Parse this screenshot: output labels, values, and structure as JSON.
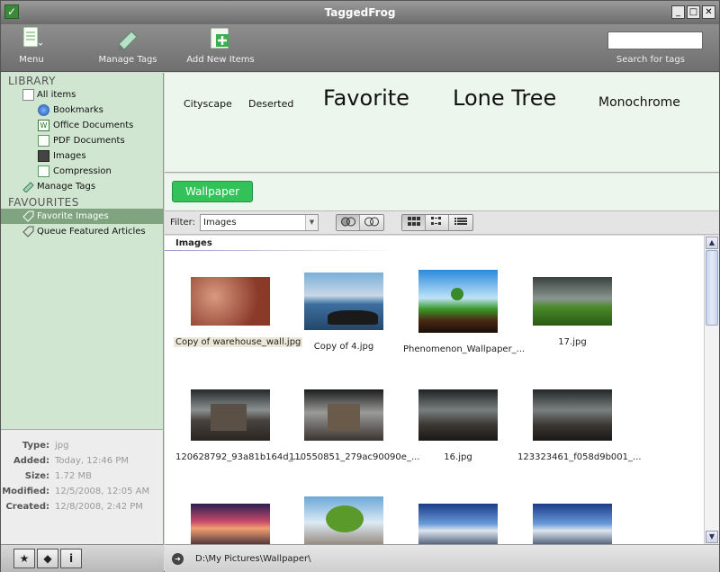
{
  "window": {
    "title": "TaggedFrog",
    "btn_min": "_",
    "btn_max": "□",
    "btn_close": "✕"
  },
  "toolbar": {
    "menu": "Menu",
    "manage_tags": "Manage Tags",
    "add_new_items": "Add New Items",
    "search_label": "Search for tags",
    "search_value": ""
  },
  "sidebar": {
    "library_header": "LIBRARY",
    "items": [
      "All items",
      "Bookmarks",
      "Office Documents",
      "PDF Documents",
      "Images",
      "Compression",
      "Manage Tags"
    ],
    "favourites_header": "FAVOURITES",
    "favourites": [
      "Favorite Images",
      "Queue Featured Articles"
    ]
  },
  "properties": [
    {
      "key": "Type:",
      "value": "jpg"
    },
    {
      "key": "Added:",
      "value": "Today, 12:46 PM"
    },
    {
      "key": "Size:",
      "value": "1.72 MB"
    },
    {
      "key": "Modified:",
      "value": "12/5/2008, 12:05 AM"
    },
    {
      "key": "Created:",
      "value": "12/8/2008, 2:42 PM"
    }
  ],
  "tagcloud": [
    "Cityscape",
    "Deserted",
    "Favorite",
    "Lone Tree",
    "Monochrome"
  ],
  "selected_tag": "Wallpaper",
  "filter": {
    "label": "Filter:",
    "value": "Images"
  },
  "group_header": "Images",
  "captions": [
    "Copy of warehouse_wall.jpg",
    "Copy of 4.jpg",
    "Phenomenon_Wallpaper_...",
    "17.jpg",
    "120628792_93a81b164d_...",
    "110550851_279ac90090e_...",
    "16.jpg",
    "123323461_f058d9b001_..."
  ],
  "status": {
    "path": "D:\\My Pictures\\Wallpaper\\"
  },
  "colors": {
    "accent_green": "#33c25a",
    "sidebar_bg": "#d1e6d1"
  }
}
